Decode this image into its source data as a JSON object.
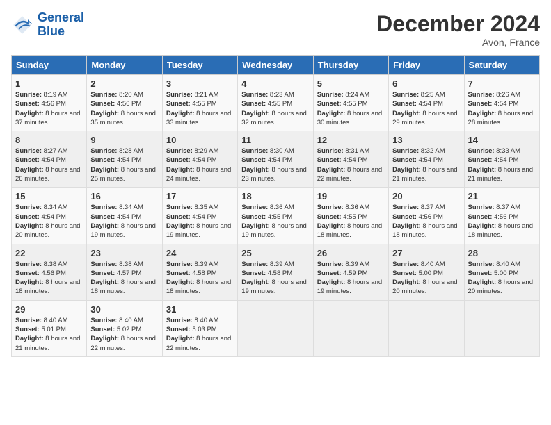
{
  "header": {
    "logo_line1": "General",
    "logo_line2": "Blue",
    "month": "December 2024",
    "location": "Avon, France"
  },
  "weekdays": [
    "Sunday",
    "Monday",
    "Tuesday",
    "Wednesday",
    "Thursday",
    "Friday",
    "Saturday"
  ],
  "weeks": [
    [
      {
        "day": "1",
        "sunrise": "8:19 AM",
        "sunset": "4:56 PM",
        "daylight": "8 hours and 37 minutes."
      },
      {
        "day": "2",
        "sunrise": "8:20 AM",
        "sunset": "4:56 PM",
        "daylight": "8 hours and 35 minutes."
      },
      {
        "day": "3",
        "sunrise": "8:21 AM",
        "sunset": "4:55 PM",
        "daylight": "8 hours and 33 minutes."
      },
      {
        "day": "4",
        "sunrise": "8:23 AM",
        "sunset": "4:55 PM",
        "daylight": "8 hours and 32 minutes."
      },
      {
        "day": "5",
        "sunrise": "8:24 AM",
        "sunset": "4:55 PM",
        "daylight": "8 hours and 30 minutes."
      },
      {
        "day": "6",
        "sunrise": "8:25 AM",
        "sunset": "4:54 PM",
        "daylight": "8 hours and 29 minutes."
      },
      {
        "day": "7",
        "sunrise": "8:26 AM",
        "sunset": "4:54 PM",
        "daylight": "8 hours and 28 minutes."
      }
    ],
    [
      {
        "day": "8",
        "sunrise": "8:27 AM",
        "sunset": "4:54 PM",
        "daylight": "8 hours and 26 minutes."
      },
      {
        "day": "9",
        "sunrise": "8:28 AM",
        "sunset": "4:54 PM",
        "daylight": "8 hours and 25 minutes."
      },
      {
        "day": "10",
        "sunrise": "8:29 AM",
        "sunset": "4:54 PM",
        "daylight": "8 hours and 24 minutes."
      },
      {
        "day": "11",
        "sunrise": "8:30 AM",
        "sunset": "4:54 PM",
        "daylight": "8 hours and 23 minutes."
      },
      {
        "day": "12",
        "sunrise": "8:31 AM",
        "sunset": "4:54 PM",
        "daylight": "8 hours and 22 minutes."
      },
      {
        "day": "13",
        "sunrise": "8:32 AM",
        "sunset": "4:54 PM",
        "daylight": "8 hours and 21 minutes."
      },
      {
        "day": "14",
        "sunrise": "8:33 AM",
        "sunset": "4:54 PM",
        "daylight": "8 hours and 21 minutes."
      }
    ],
    [
      {
        "day": "15",
        "sunrise": "8:34 AM",
        "sunset": "4:54 PM",
        "daylight": "8 hours and 20 minutes."
      },
      {
        "day": "16",
        "sunrise": "8:34 AM",
        "sunset": "4:54 PM",
        "daylight": "8 hours and 19 minutes."
      },
      {
        "day": "17",
        "sunrise": "8:35 AM",
        "sunset": "4:54 PM",
        "daylight": "8 hours and 19 minutes."
      },
      {
        "day": "18",
        "sunrise": "8:36 AM",
        "sunset": "4:55 PM",
        "daylight": "8 hours and 19 minutes."
      },
      {
        "day": "19",
        "sunrise": "8:36 AM",
        "sunset": "4:55 PM",
        "daylight": "8 hours and 18 minutes."
      },
      {
        "day": "20",
        "sunrise": "8:37 AM",
        "sunset": "4:56 PM",
        "daylight": "8 hours and 18 minutes."
      },
      {
        "day": "21",
        "sunrise": "8:37 AM",
        "sunset": "4:56 PM",
        "daylight": "8 hours and 18 minutes."
      }
    ],
    [
      {
        "day": "22",
        "sunrise": "8:38 AM",
        "sunset": "4:56 PM",
        "daylight": "8 hours and 18 minutes."
      },
      {
        "day": "23",
        "sunrise": "8:38 AM",
        "sunset": "4:57 PM",
        "daylight": "8 hours and 18 minutes."
      },
      {
        "day": "24",
        "sunrise": "8:39 AM",
        "sunset": "4:58 PM",
        "daylight": "8 hours and 18 minutes."
      },
      {
        "day": "25",
        "sunrise": "8:39 AM",
        "sunset": "4:58 PM",
        "daylight": "8 hours and 19 minutes."
      },
      {
        "day": "26",
        "sunrise": "8:39 AM",
        "sunset": "4:59 PM",
        "daylight": "8 hours and 19 minutes."
      },
      {
        "day": "27",
        "sunrise": "8:40 AM",
        "sunset": "5:00 PM",
        "daylight": "8 hours and 20 minutes."
      },
      {
        "day": "28",
        "sunrise": "8:40 AM",
        "sunset": "5:00 PM",
        "daylight": "8 hours and 20 minutes."
      }
    ],
    [
      {
        "day": "29",
        "sunrise": "8:40 AM",
        "sunset": "5:01 PM",
        "daylight": "8 hours and 21 minutes."
      },
      {
        "day": "30",
        "sunrise": "8:40 AM",
        "sunset": "5:02 PM",
        "daylight": "8 hours and 22 minutes."
      },
      {
        "day": "31",
        "sunrise": "8:40 AM",
        "sunset": "5:03 PM",
        "daylight": "8 hours and 22 minutes."
      },
      null,
      null,
      null,
      null
    ]
  ],
  "labels": {
    "sunrise": "Sunrise:",
    "sunset": "Sunset:",
    "daylight": "Daylight:"
  }
}
